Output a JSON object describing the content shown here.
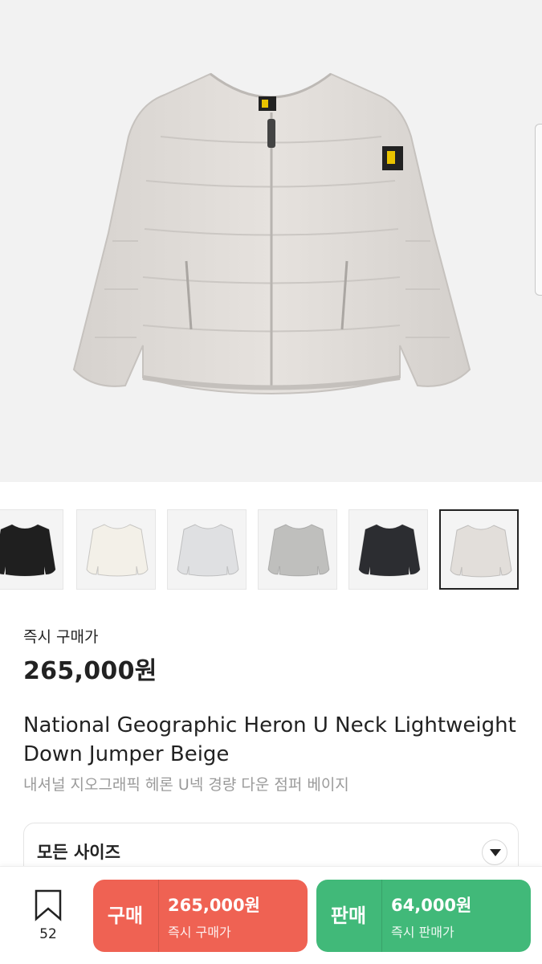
{
  "product": {
    "price_label": "즉시 구매가",
    "price": "265,000원",
    "name_en": "National Geographic Heron U Neck Lightweight Down Jumper Beige",
    "name_ko": "내셔널 지오그래픽 헤론 U넥 경량 다운 점퍼 베이지"
  },
  "thumbnails": [
    {
      "color_name": "black",
      "color": "#1f1f1f"
    },
    {
      "color_name": "ivory",
      "color": "#f3f0e8"
    },
    {
      "color_name": "light-grey",
      "color": "#dfe0e2"
    },
    {
      "color_name": "grey",
      "color": "#bfbfbd"
    },
    {
      "color_name": "charcoal",
      "color": "#2c2d31"
    },
    {
      "color_name": "beige",
      "color": "#e2deda"
    }
  ],
  "selected_thumbnail": 5,
  "size_selector": {
    "label": "모든 사이즈"
  },
  "bottom_bar": {
    "bookmark_count": "52",
    "buy": {
      "label": "구매",
      "price": "265,000원",
      "sub": "즉시 구매가"
    },
    "sell": {
      "label": "판매",
      "price": "64,000원",
      "sub": "즉시 판매가"
    }
  },
  "colors": {
    "buy": "#ef6253",
    "sell": "#41b979",
    "jacket_main": "#e2deda"
  }
}
